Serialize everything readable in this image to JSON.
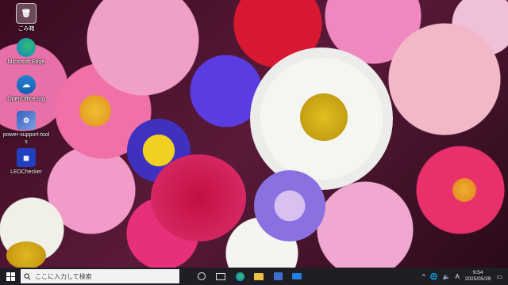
{
  "desktop": {
    "icons": [
      {
        "label": "ごみ箱",
        "icon": "recycle-bin-icon"
      },
      {
        "label": "Microsoft Edge",
        "icon": "edge-icon"
      },
      {
        "label": "OpenOffice.org",
        "icon": "openoffice-icon"
      },
      {
        "label": "power-support-tools",
        "icon": "app-icon"
      },
      {
        "label": "LEDChecker",
        "icon": "led-icon"
      }
    ]
  },
  "taskbar": {
    "search_placeholder": "ここに入力して検索",
    "tray": {
      "chevron": "^",
      "ime": "A",
      "time": "9:54",
      "date": "2025/05/29"
    }
  }
}
